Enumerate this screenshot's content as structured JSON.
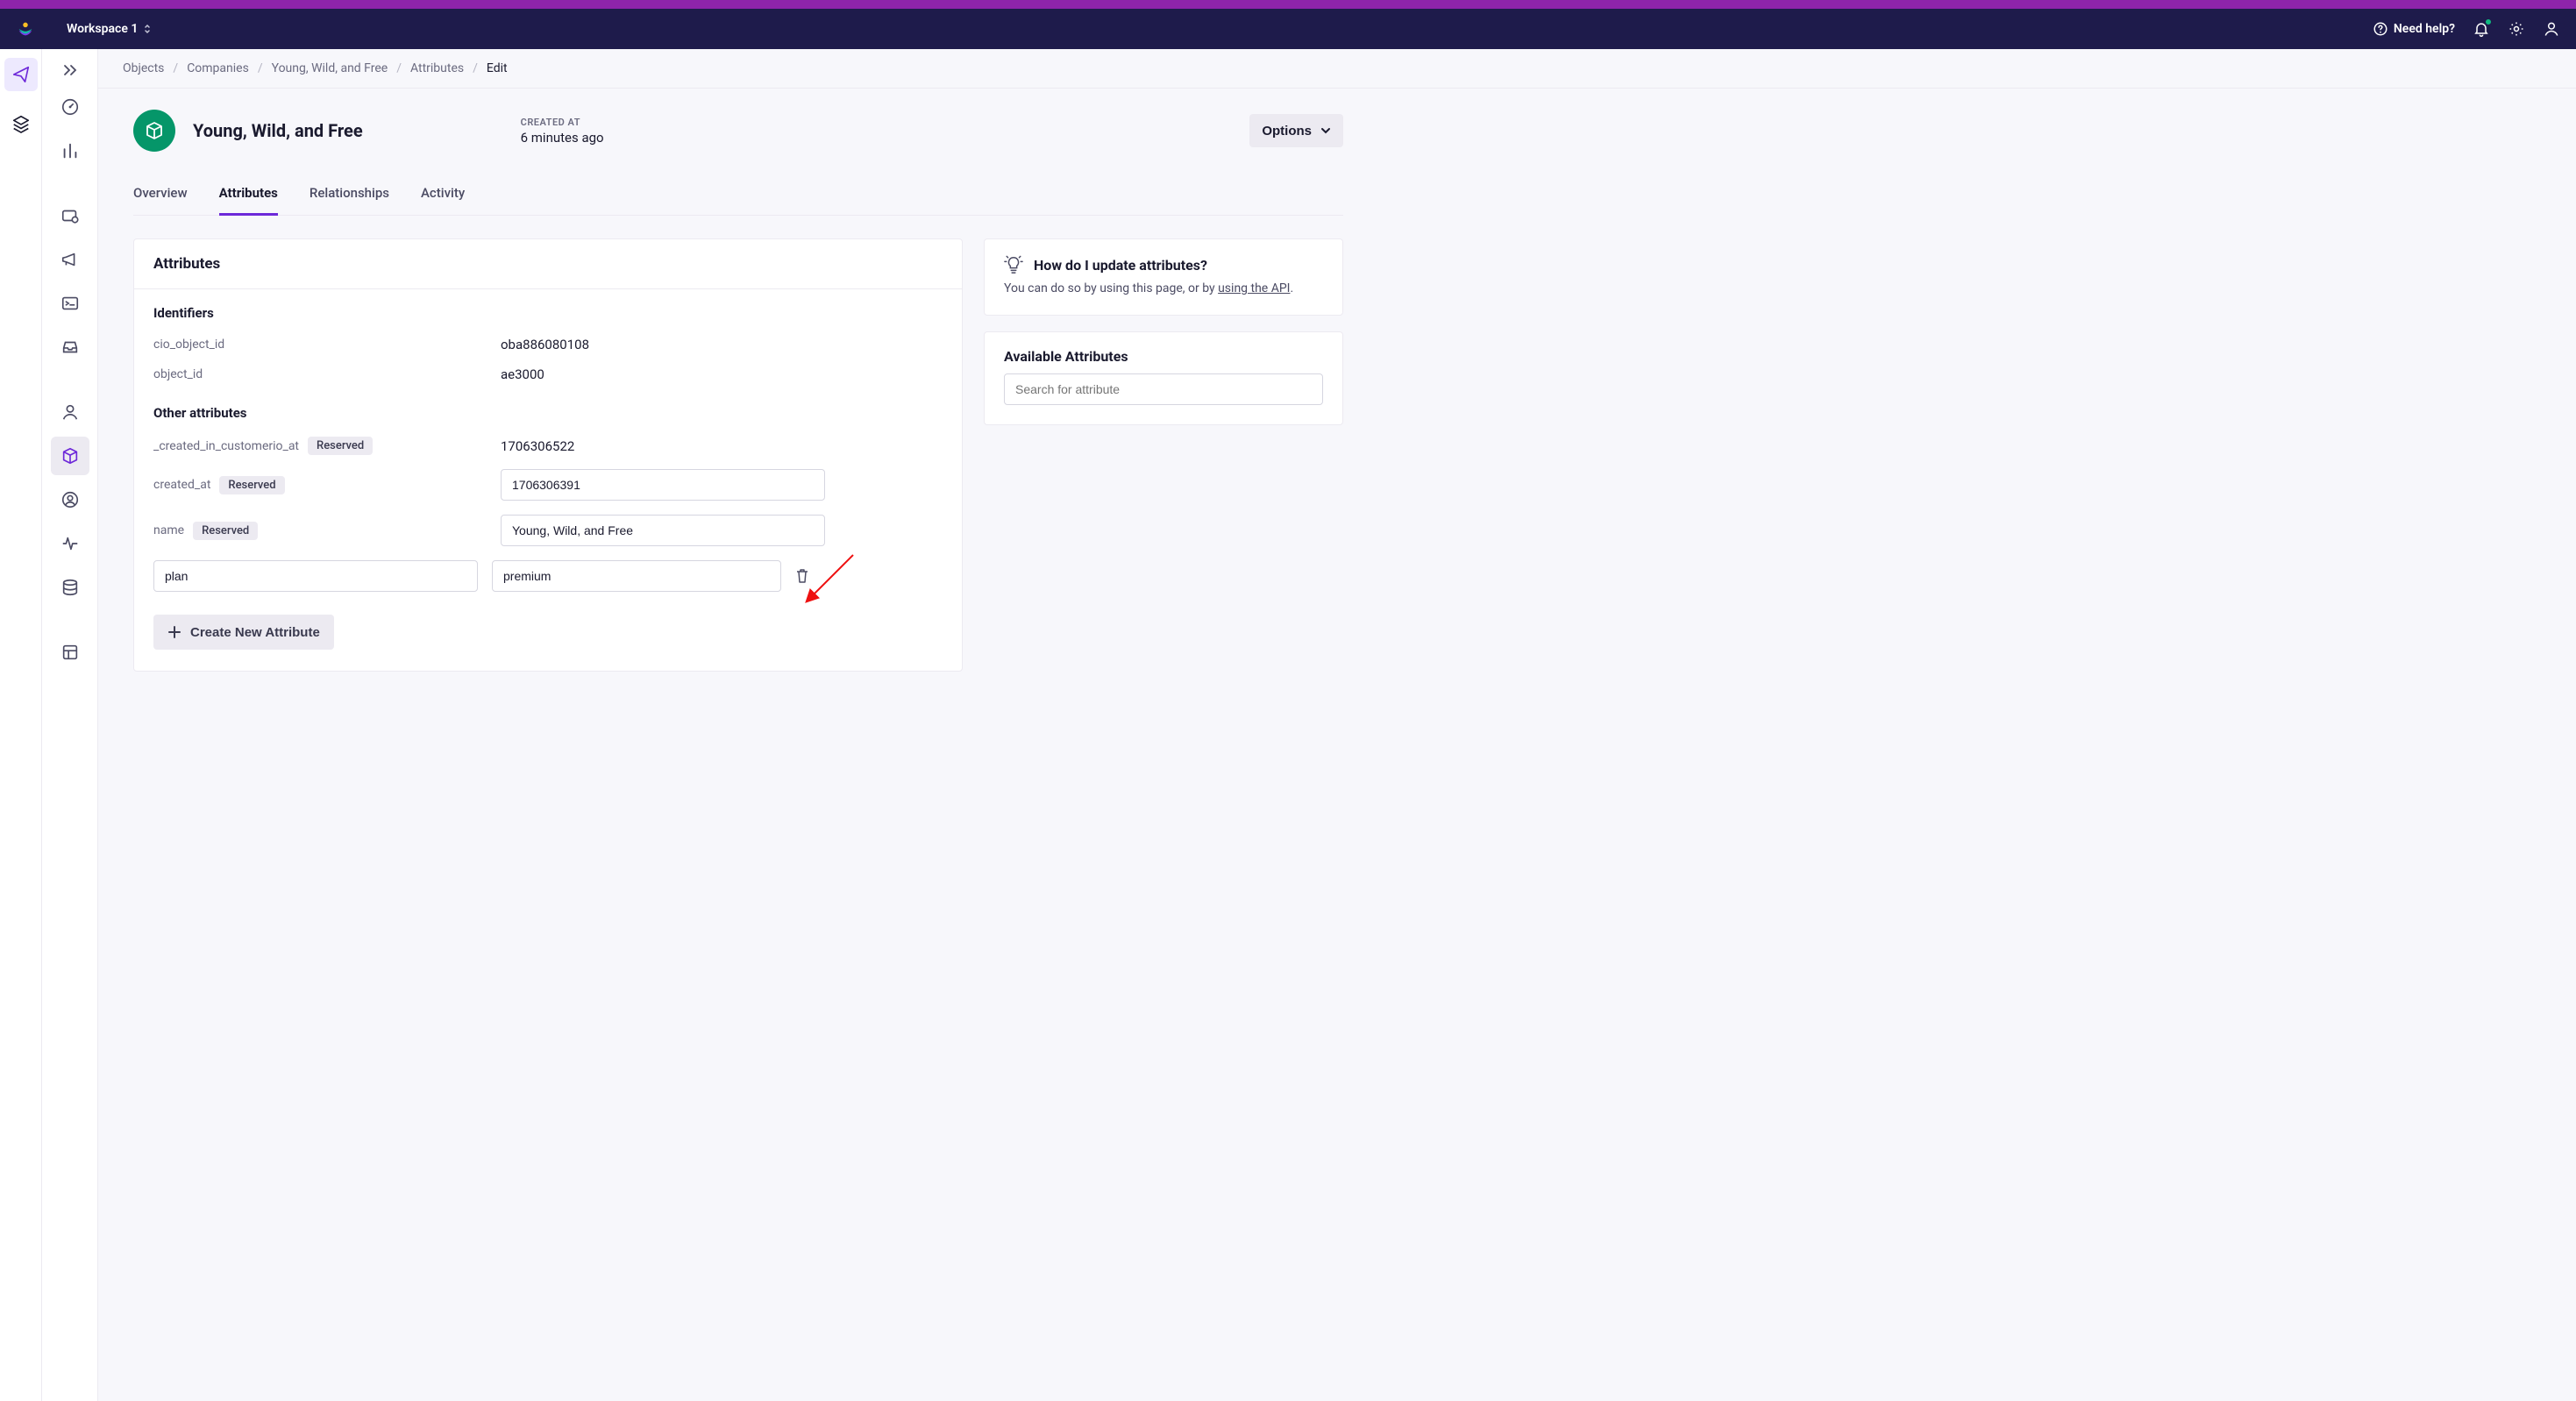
{
  "top": {
    "workspace_label": "Workspace 1",
    "help_label": "Need help?"
  },
  "breadcrumb": {
    "items": [
      "Objects",
      "Companies",
      "Young, Wild, and Free",
      "Attributes"
    ],
    "current": "Edit"
  },
  "header": {
    "title": "Young, Wild, and Free",
    "created_at_label": "CREATED AT",
    "created_at_value": "6 minutes ago",
    "options_label": "Options"
  },
  "tabs": {
    "items": [
      "Overview",
      "Attributes",
      "Relationships",
      "Activity"
    ],
    "active": "Attributes"
  },
  "attributes": {
    "panel_title": "Attributes",
    "identifiers_title": "Identifiers",
    "identifiers": [
      {
        "name": "cio_object_id",
        "value": "oba886080108"
      },
      {
        "name": "object_id",
        "value": "ae3000"
      }
    ],
    "other_title": "Other attributes",
    "reserved_label": "Reserved",
    "readonly": {
      "name": "_created_in_customerio_at",
      "value": "1706306522"
    },
    "editable": [
      {
        "name": "created_at",
        "value": "1706306391"
      },
      {
        "name": "name",
        "value": "Young, Wild, and Free"
      }
    ],
    "custom": {
      "name": "plan",
      "value": "premium"
    },
    "create_label": "Create New Attribute"
  },
  "hint": {
    "title": "How do I update attributes?",
    "body_pre": "You can do so by using this page, or by ",
    "body_link": "using the API",
    "body_post": "."
  },
  "available": {
    "title": "Available Attributes",
    "search_placeholder": "Search for attribute"
  }
}
